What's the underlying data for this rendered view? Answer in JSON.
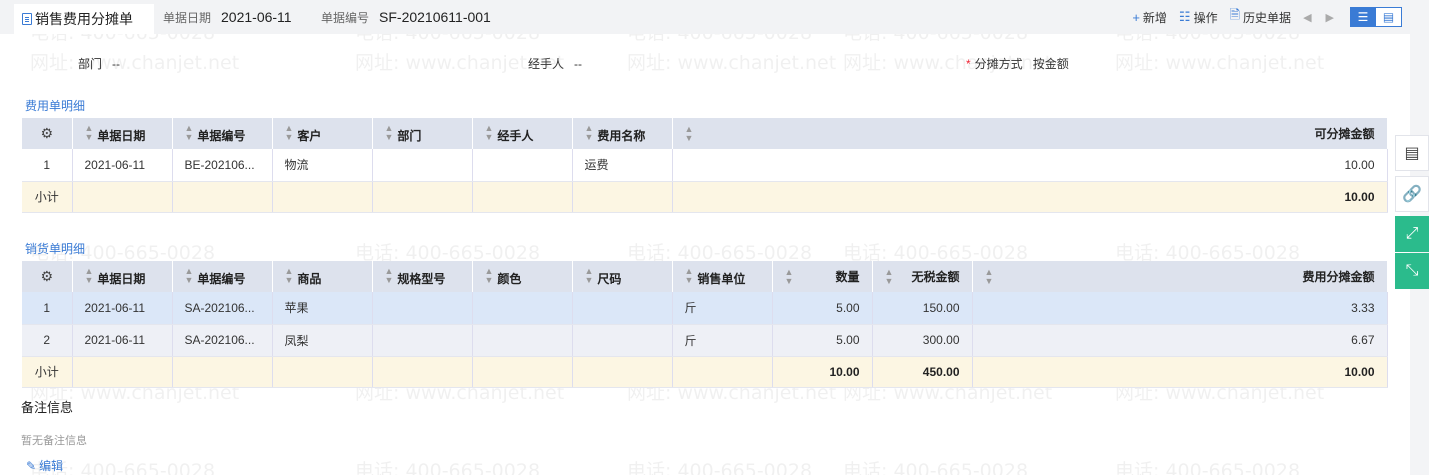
{
  "watermark": {
    "phone": "电话: 400-665-0028",
    "site": "网址: www.chanjet.net"
  },
  "header": {
    "tab_title": "销售费用分摊单",
    "date_label": "单据日期",
    "date_value": "2021-06-11",
    "code_label": "单据编号",
    "code_value": "SF-20210611-001"
  },
  "toolbar": {
    "new_label": "新增",
    "ops_label": "操作",
    "history_label": "历史单据"
  },
  "form": {
    "dept_label": "部门",
    "dept_value": "--",
    "handler_label": "经手人",
    "handler_value": "--",
    "alloc_label": "分摊方式",
    "alloc_value": "按金额"
  },
  "expense_section": {
    "title": "费用单明细",
    "headers": [
      "单据日期",
      "单据编号",
      "客户",
      "部门",
      "经手人",
      "费用名称",
      "可分摊金额"
    ],
    "rows": [
      {
        "no": "1",
        "date": "2021-06-11",
        "code": "BE-202106...",
        "customer": "物流",
        "dept": "",
        "handler": "",
        "expense": "运费",
        "amount": "10.00"
      }
    ],
    "subtotal_label": "小计",
    "subtotal_amount": "10.00"
  },
  "sales_section": {
    "title": "销货单明细",
    "headers": [
      "单据日期",
      "单据编号",
      "商品",
      "规格型号",
      "颜色",
      "尺码",
      "销售单位",
      "数量",
      "无税金额",
      "费用分摊金额"
    ],
    "rows": [
      {
        "no": "1",
        "date": "2021-06-11",
        "code": "SA-202106...",
        "product": "苹果",
        "spec": "",
        "color": "",
        "size": "",
        "unit": "斤",
        "qty": "5.00",
        "amount": "150.00",
        "share": "3.33"
      },
      {
        "no": "2",
        "date": "2021-06-11",
        "code": "SA-202106...",
        "product": "凤梨",
        "spec": "",
        "color": "",
        "size": "",
        "unit": "斤",
        "qty": "5.00",
        "amount": "300.00",
        "share": "6.67"
      }
    ],
    "subtotal_label": "小计",
    "subtotal_qty": "10.00",
    "subtotal_amount": "450.00",
    "subtotal_share": "10.00"
  },
  "remark": {
    "title": "备注信息",
    "empty_text": "暂无备注信息",
    "edit_label": "编辑"
  },
  "icons": {
    "settings": "gear-icon",
    "document": "document-icon",
    "link": "link-icon",
    "expand": "expand-icon",
    "collapse": "collapse-icon"
  },
  "colors": {
    "accent": "#3a7bd5",
    "header_bg": "#dde2ed",
    "subtotal_bg": "#fcf6e3",
    "selected_row": "#dbe7f8",
    "side_green": "#2bbb8c",
    "required": "#e23"
  }
}
